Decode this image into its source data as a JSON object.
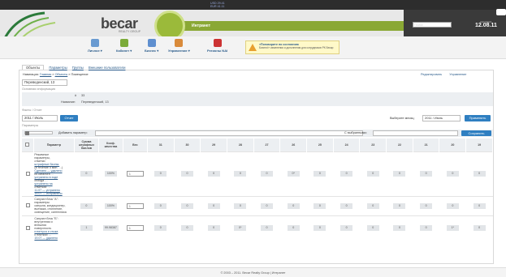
{
  "header": {
    "rates": [
      "USD 29.41",
      "EUR 41.11"
    ],
    "logo_text": "becar",
    "logo_subtext": "REALTY GROUP",
    "intranet_label": "Интранет",
    "search_placeholder": "Поиск",
    "today_label": "СЕГОДНЯ",
    "date": "12.08.11"
  },
  "nav": {
    "items": [
      {
        "label": "Личное ▾",
        "icon": "user-icon",
        "color": "#6a9bd1"
      },
      {
        "label": "Кабинет ▾",
        "icon": "cabinet-icon",
        "color": "#7cab3a"
      },
      {
        "label": "Бизнес ▾",
        "icon": "business-icon",
        "color": "#5f8fcf"
      },
      {
        "label": "Управление ▾",
        "icon": "management-icon",
        "color": "#d98a3a"
      },
      {
        "label": "Регионы NAI",
        "icon": "nai-logo-icon",
        "color": "#c33"
      }
    ]
  },
  "notice": {
    "title": "«Поговорите по состоянию",
    "link": "Бизнес!» изменения и дополнения для сотрудников РК Бекар"
  },
  "tabs": [
    "Объекты",
    "Параметры",
    "Группы",
    "Внешние пользователи"
  ],
  "breadcrumb": {
    "prefix": "Навигация:",
    "home": "Главная",
    "objects": "Объекты",
    "current": "Помещение"
  },
  "actions": {
    "edit": "Редактировать",
    "manage": "Управление"
  },
  "room_select": "Переведенский, 13",
  "basic_info_title": "Основная информация",
  "info": {
    "id_label": "#",
    "id_value": "33",
    "name_label": "Название:",
    "name_value": "Переведенский, 13"
  },
  "facts_title": "Факты / Отчет",
  "period_select": "2011 / Июль",
  "show_button": "Отчет",
  "choose_period_label": "Выберите месяц:",
  "choose_period_select": "2011 / Июль",
  "apply_button": "Применить",
  "params_title": "Параметры",
  "params_bar": {
    "add_label": "Добавить параметр:",
    "selected_label": "С выбранными:",
    "save_button": "Сохранить"
  },
  "table": {
    "headers": [
      "",
      "Параметр",
      "Сумма штрафных баллов",
      "Коэф. качества",
      "Вес",
      "31",
      "30",
      "29",
      "28",
      "27",
      "26",
      "25",
      "24",
      "23",
      "22",
      "21",
      "20",
      "19"
    ],
    "rows": [
      {
        "name_lines": [
          "Режимные",
          "параметры,",
          "отметки",
          "штрафные баллы:",
          "(в течение 5 мин. …)",
          "Сделано — удалено",
          "из каталога …",
          "устранено в ходе",
          "обхода …",
          "устранено на",
          "отметках …",
          "11.07 — устранено",
          "19.07 — исправлено"
        ],
        "sum": "0",
        "coef": "100%",
        "weight": "1",
        "days": [
          "0",
          "0",
          "0",
          "0",
          "0",
          "0*",
          "0",
          "0",
          "0",
          "0",
          "0",
          "0",
          "0"
        ]
      },
      {
        "name_lines": [
          "Санузел блок \"А\":",
          "параметры",
          "санузла, кондиционер,",
          "вытяжка, отопление,",
          "освещение, сантехника"
        ],
        "sum": "0",
        "coef": "100%",
        "weight": "1",
        "days": [
          "0",
          "0",
          "0",
          "0",
          "0",
          "0",
          "0",
          "0",
          "0",
          "0",
          "0",
          "0",
          "0"
        ]
      },
      {
        "name_lines": [
          "Санузел блок \"Б\":",
          "внутренняя и",
          "внешняя",
          "поверхность",
          "плинтуса и стыка",
          "с плиткой …",
          "19.07 — удалено"
        ],
        "sum": "1",
        "coef": "99.98387",
        "weight": "1",
        "days": [
          "0",
          "0",
          "0",
          "0*",
          "0",
          "0",
          "0",
          "0",
          "0",
          "0",
          "0",
          "1*",
          "0"
        ]
      }
    ]
  },
  "footer": "© 2003 – 2011. Becar Realty Group | Интранет"
}
